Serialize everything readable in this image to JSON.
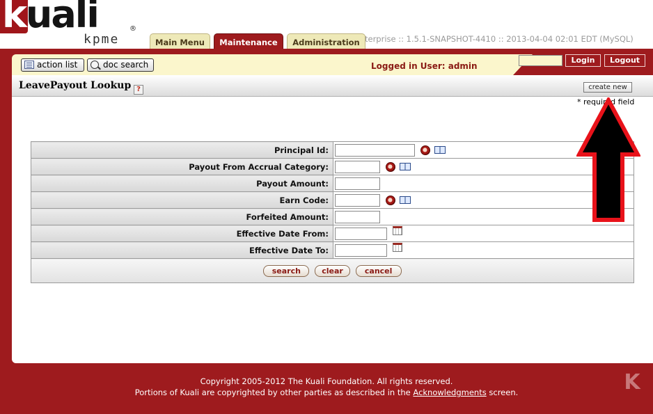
{
  "brand": {
    "name": "kuali",
    "subtitle": "kpme",
    "reg_mark": "®"
  },
  "header": {
    "version_info": "terprise :: 1.5.1-SNAPSHOT-4410 :: 2013-04-04 02:01 EDT (MySQL)",
    "tabs": [
      {
        "label": "Main Menu",
        "active": false
      },
      {
        "label": "Maintenance",
        "active": true
      },
      {
        "label": "Administration",
        "active": false
      }
    ]
  },
  "toolbar": {
    "action_list_label": "action list",
    "doc_search_label": "doc search",
    "logged_in_text": "Logged in User: admin",
    "login_label": "Login",
    "logout_label": "Logout",
    "login_input_value": ""
  },
  "page": {
    "title": "LeavePayout Lookup",
    "help_glyph": "?",
    "create_new_label": "create new",
    "required_note": "* required field"
  },
  "form": {
    "fields": [
      {
        "label": "Principal Id:",
        "value": ""
      },
      {
        "label": "Payout From Accrual Category:",
        "value": ""
      },
      {
        "label": "Payout Amount:",
        "value": ""
      },
      {
        "label": "Earn Code:",
        "value": ""
      },
      {
        "label": "Forfeited Amount:",
        "value": ""
      },
      {
        "label": "Effective Date From:",
        "value": ""
      },
      {
        "label": "Effective Date To:",
        "value": ""
      }
    ],
    "search_label": "search",
    "clear_label": "clear",
    "cancel_label": "cancel"
  },
  "footer": {
    "copyright": "Copyright 2005-2012 The Kuali Foundation. All rights reserved.",
    "portions_prefix": "Portions of Kuali are copyrighted by other parties as described in the",
    "acknowledgments_link": "Acknowledgments",
    "portions_suffix": "screen."
  },
  "colors": {
    "brand_red": "#9e1b1e",
    "toolbar_cream": "#fbf6cc",
    "tab_inactive": "#eee9b8",
    "arrow_red": "#e8121a"
  },
  "icons": [
    "lookup-magnifier-icon",
    "inquiry-book-icon",
    "calendar-icon",
    "help-icon",
    "action-list-icon",
    "doc-search-icon"
  ]
}
